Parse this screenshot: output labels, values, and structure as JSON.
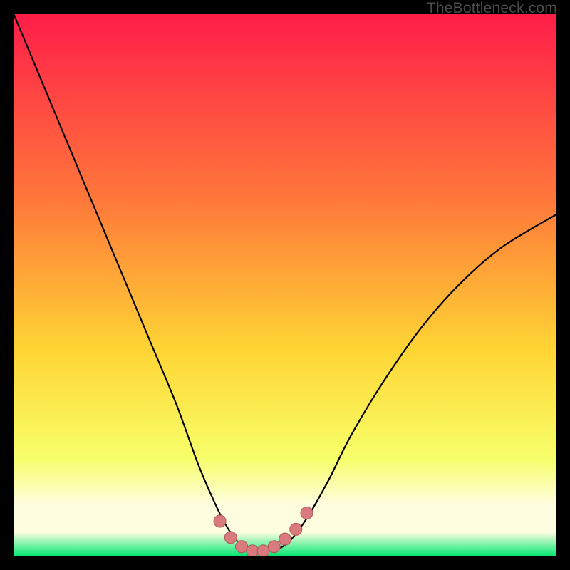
{
  "watermark": "TheBottleneck.com",
  "colors": {
    "background": "#000000",
    "gradient_top": "#ff1d49",
    "gradient_mid_upper": "#ff7a3a",
    "gradient_mid": "#ffd534",
    "gradient_lower": "#f7ff6a",
    "gradient_band": "#fffde0",
    "gradient_bottom": "#00e770",
    "curve": "#000000",
    "markers_fill": "#d97a7f",
    "markers_stroke": "#b15258"
  },
  "chart_data": {
    "type": "line",
    "title": "",
    "xlabel": "",
    "ylabel": "",
    "xlim": [
      0,
      100
    ],
    "ylim": [
      0,
      100
    ],
    "series": [
      {
        "name": "bottleneck-curve",
        "x": [
          0,
          5,
          10,
          15,
          20,
          25,
          30,
          34,
          37,
          39,
          41,
          43,
          45,
          47,
          49,
          51,
          54,
          58,
          62,
          68,
          75,
          82,
          90,
          100
        ],
        "y": [
          100,
          88,
          76,
          64,
          52,
          40,
          28,
          17,
          10,
          6,
          3,
          1.5,
          1,
          1,
          1.5,
          3,
          7,
          14,
          22,
          32,
          42,
          50,
          57,
          63
        ]
      }
    ],
    "markers": {
      "name": "trough-markers",
      "x": [
        38,
        40,
        42,
        44,
        46,
        48,
        50,
        52,
        54
      ],
      "y": [
        6.5,
        3.5,
        1.8,
        1.0,
        1.0,
        1.8,
        3.2,
        5.0,
        8.0
      ]
    }
  }
}
